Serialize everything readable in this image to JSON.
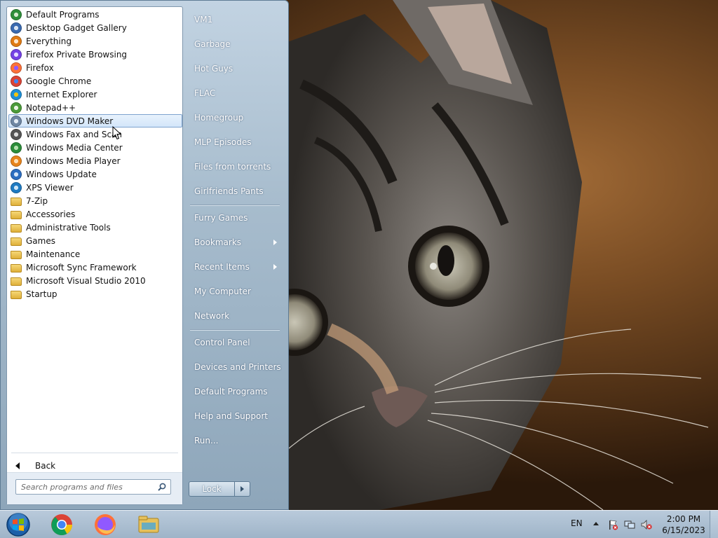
{
  "programs": [
    {
      "label": "Default Programs",
      "icon": "default-programs-icon"
    },
    {
      "label": "Desktop Gadget Gallery",
      "icon": "gadget-gallery-icon"
    },
    {
      "label": "Everything",
      "icon": "search-magnifier-icon"
    },
    {
      "label": "Firefox Private Browsing",
      "icon": "firefox-private-icon"
    },
    {
      "label": "Firefox",
      "icon": "firefox-icon"
    },
    {
      "label": "Google Chrome",
      "icon": "chrome-icon"
    },
    {
      "label": "Internet Explorer",
      "icon": "internet-explorer-icon"
    },
    {
      "label": "Notepad++",
      "icon": "notepadpp-icon"
    },
    {
      "label": "Windows DVD Maker",
      "icon": "dvd-maker-icon"
    },
    {
      "label": "Windows Fax and Scan",
      "icon": "fax-scan-icon"
    },
    {
      "label": "Windows Media Center",
      "icon": "media-center-icon"
    },
    {
      "label": "Windows Media Player",
      "icon": "media-player-icon"
    },
    {
      "label": "Windows Update",
      "icon": "windows-update-icon"
    },
    {
      "label": "XPS Viewer",
      "icon": "xps-viewer-icon"
    },
    {
      "label": "7-Zip",
      "icon": "folder-icon"
    },
    {
      "label": "Accessories",
      "icon": "folder-icon"
    },
    {
      "label": "Administrative Tools",
      "icon": "folder-icon"
    },
    {
      "label": "Games",
      "icon": "folder-icon"
    },
    {
      "label": "Maintenance",
      "icon": "folder-icon"
    },
    {
      "label": "Microsoft Sync Framework",
      "icon": "folder-icon"
    },
    {
      "label": "Microsoft Visual Studio 2010",
      "icon": "folder-icon"
    },
    {
      "label": "Startup",
      "icon": "folder-icon"
    }
  ],
  "highlighted_program": "Windows DVD Maker",
  "back_label": "Back",
  "search": {
    "placeholder": "Search programs and files",
    "value": ""
  },
  "right_items": {
    "vm1": "VM1",
    "garbage": "Garbage",
    "hot_guys": "Hot Guys",
    "flac": "FLAC",
    "homegroup": "Homegroup",
    "mlp_episodes": "MLP Episodes",
    "files_from_torrents": "Files from torrents",
    "girlfriends_pants": "Girlfriends Pants",
    "furry_games": "Furry Games",
    "bookmarks": "Bookmarks",
    "recent_items": "Recent Items",
    "my_computer": "My Computer",
    "network": "Network",
    "control_panel": "Control Panel",
    "devices_and_printers": "Devices and Printers",
    "default_programs": "Default Programs",
    "help_and_support": "Help and Support",
    "run": "Run..."
  },
  "lock_label": "Lock",
  "taskbar": {
    "pinned": [
      "chrome-icon",
      "firefox-icon",
      "file-explorer-icon"
    ],
    "language": "EN",
    "time": "2:00 PM",
    "date": "6/15/2023"
  },
  "colors": {
    "highlight_border": "#7da2ce",
    "menu_glass": "#a7bccd",
    "taskbar": "#b9cadb"
  }
}
